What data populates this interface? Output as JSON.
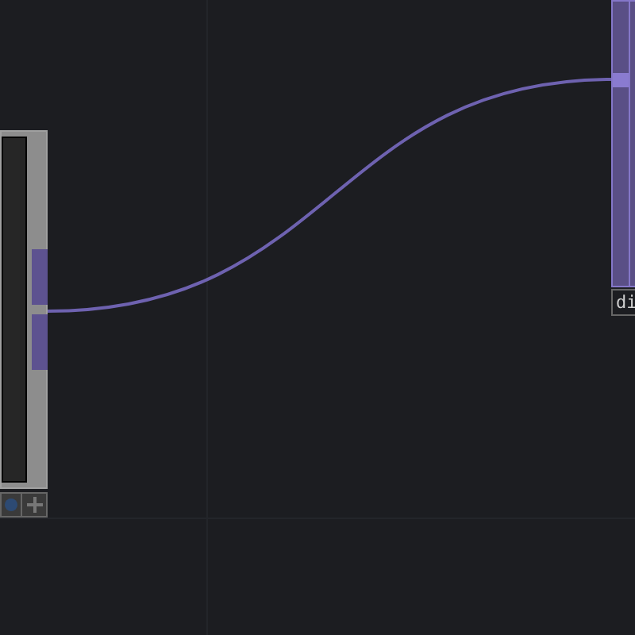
{
  "nodes": [
    {
      "kind": "source"
    },
    {
      "kind": "target",
      "label": "di"
    }
  ]
}
